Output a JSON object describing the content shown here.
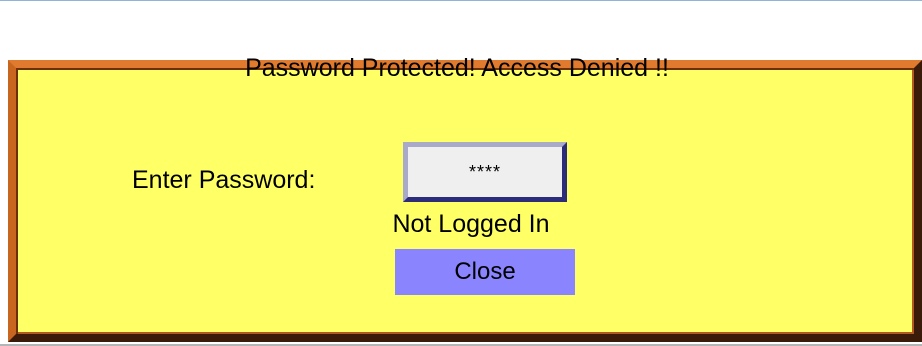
{
  "dialog": {
    "title": "Password Protected! Access Denied !!",
    "password_label": "Enter Password:",
    "password_value": "****",
    "status": "Not Logged In",
    "close_label": "Close"
  },
  "colors": {
    "dialog_background": "#ffff66",
    "border_light": "#e07a2e",
    "border_dark": "#3a1a08",
    "close_button": "#8a84ff",
    "password_field": "#efefef"
  }
}
